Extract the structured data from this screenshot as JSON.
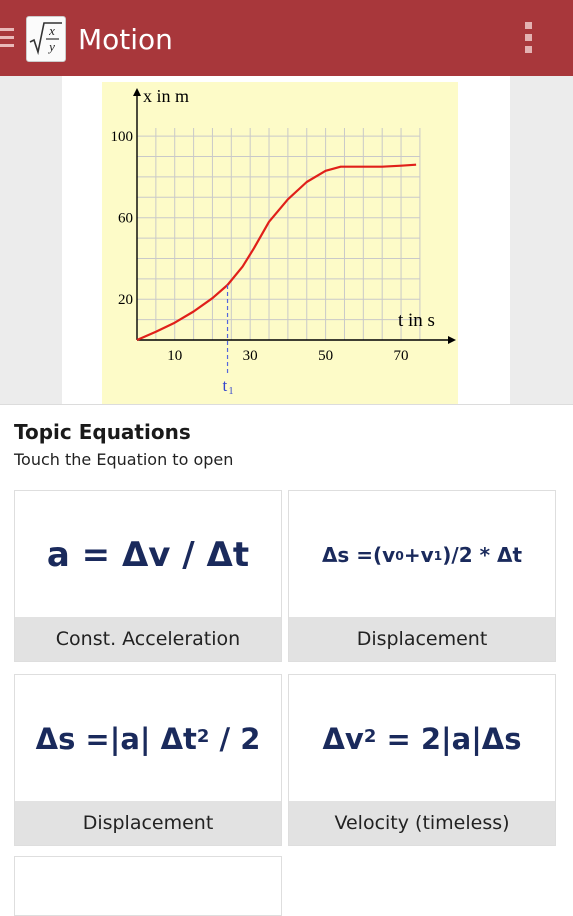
{
  "app_bar": {
    "title": "Motion",
    "color": "#a8373b",
    "logo": {
      "top": "x",
      "bottom": "y"
    }
  },
  "figure": {
    "chart_data": {
      "type": "line",
      "xlabel": "t in s",
      "ylabel": "x in m",
      "x_ticks": [
        "10",
        "30",
        "50",
        "70"
      ],
      "y_ticks": [
        "20",
        "60",
        "100"
      ],
      "marker_label": "t",
      "marker_sub": "1",
      "series": [
        {
          "color": "#e0201a",
          "x": [
            0,
            5,
            10,
            15,
            20,
            24,
            28,
            31,
            35,
            40,
            45,
            50,
            54,
            60,
            65,
            70,
            74
          ],
          "y": [
            0,
            4,
            8.5,
            14,
            20.5,
            27,
            36,
            45,
            58,
            69,
            77.5,
            83,
            85,
            85,
            85,
            85.5,
            86
          ]
        }
      ],
      "marker_x": 24,
      "xlim": [
        0,
        79
      ],
      "ylim": [
        0,
        104
      ],
      "grid": true
    }
  },
  "section": {
    "title": "Topic Equations",
    "subtitle": "Touch the Equation to open"
  },
  "cards": [
    {
      "label": "Const. Acceleration"
    },
    {
      "label": "Displacement"
    },
    {
      "label": "Displacement"
    },
    {
      "label": "Velocity (timeless)"
    }
  ],
  "formulas": {
    "f1": "a = Δv / Δt",
    "f2a": "Δs =(v",
    "f2b": "0",
    "f2c": "+v",
    "f2d": "1",
    "f2e": ")/2 * Δt",
    "f3a": "Δs =|a| Δt",
    "f3b": "2",
    "f3c": " / 2",
    "f4a": "Δv",
    "f4b": "2",
    "f4c": " = 2|a|Δs"
  }
}
